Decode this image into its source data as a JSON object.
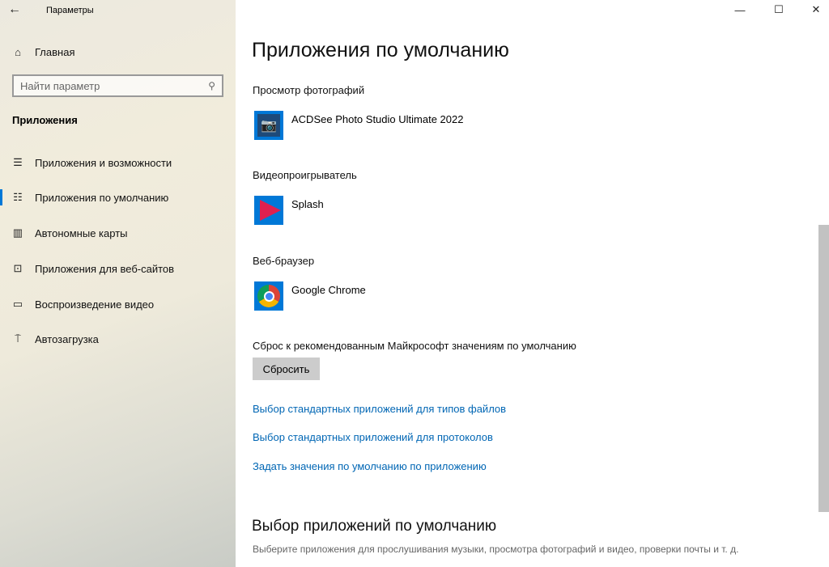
{
  "window": {
    "title": "Параметры"
  },
  "sidebar": {
    "home": "Главная",
    "search_placeholder": "Найти параметр",
    "section": "Приложения",
    "items": [
      {
        "label": "Приложения и возможности",
        "icon": "list-icon"
      },
      {
        "label": "Приложения по умолчанию",
        "icon": "list-default-icon"
      },
      {
        "label": "Автономные карты",
        "icon": "map-icon"
      },
      {
        "label": "Приложения для веб-сайтов",
        "icon": "web-app-icon"
      },
      {
        "label": "Воспроизведение видео",
        "icon": "video-icon"
      },
      {
        "label": "Автозагрузка",
        "icon": "startup-icon"
      }
    ],
    "selected": 1
  },
  "main": {
    "title": "Приложения по умолчанию",
    "photo": {
      "label": "Просмотр фотографий",
      "app": "ACDSee Photo Studio Ultimate 2022"
    },
    "video": {
      "label": "Видеопроигрыватель",
      "app": "Splash"
    },
    "browser": {
      "label": "Веб-браузер",
      "app": "Google Chrome"
    },
    "reset": {
      "label": "Сброс к рекомендованным Майкрософт значениям по умолчанию",
      "button": "Сбросить"
    },
    "links": [
      "Выбор стандартных приложений для типов файлов",
      "Выбор стандартных приложений для протоколов",
      "Задать значения по умолчанию по приложению"
    ],
    "section2": {
      "title": "Выбор приложений по умолчанию",
      "desc": "Выберите приложения для прослушивания музыки, просмотра фотографий и видео, проверки почты и т. д."
    }
  },
  "colors": {
    "accent": "#0078d7",
    "link": "#0066b4"
  }
}
